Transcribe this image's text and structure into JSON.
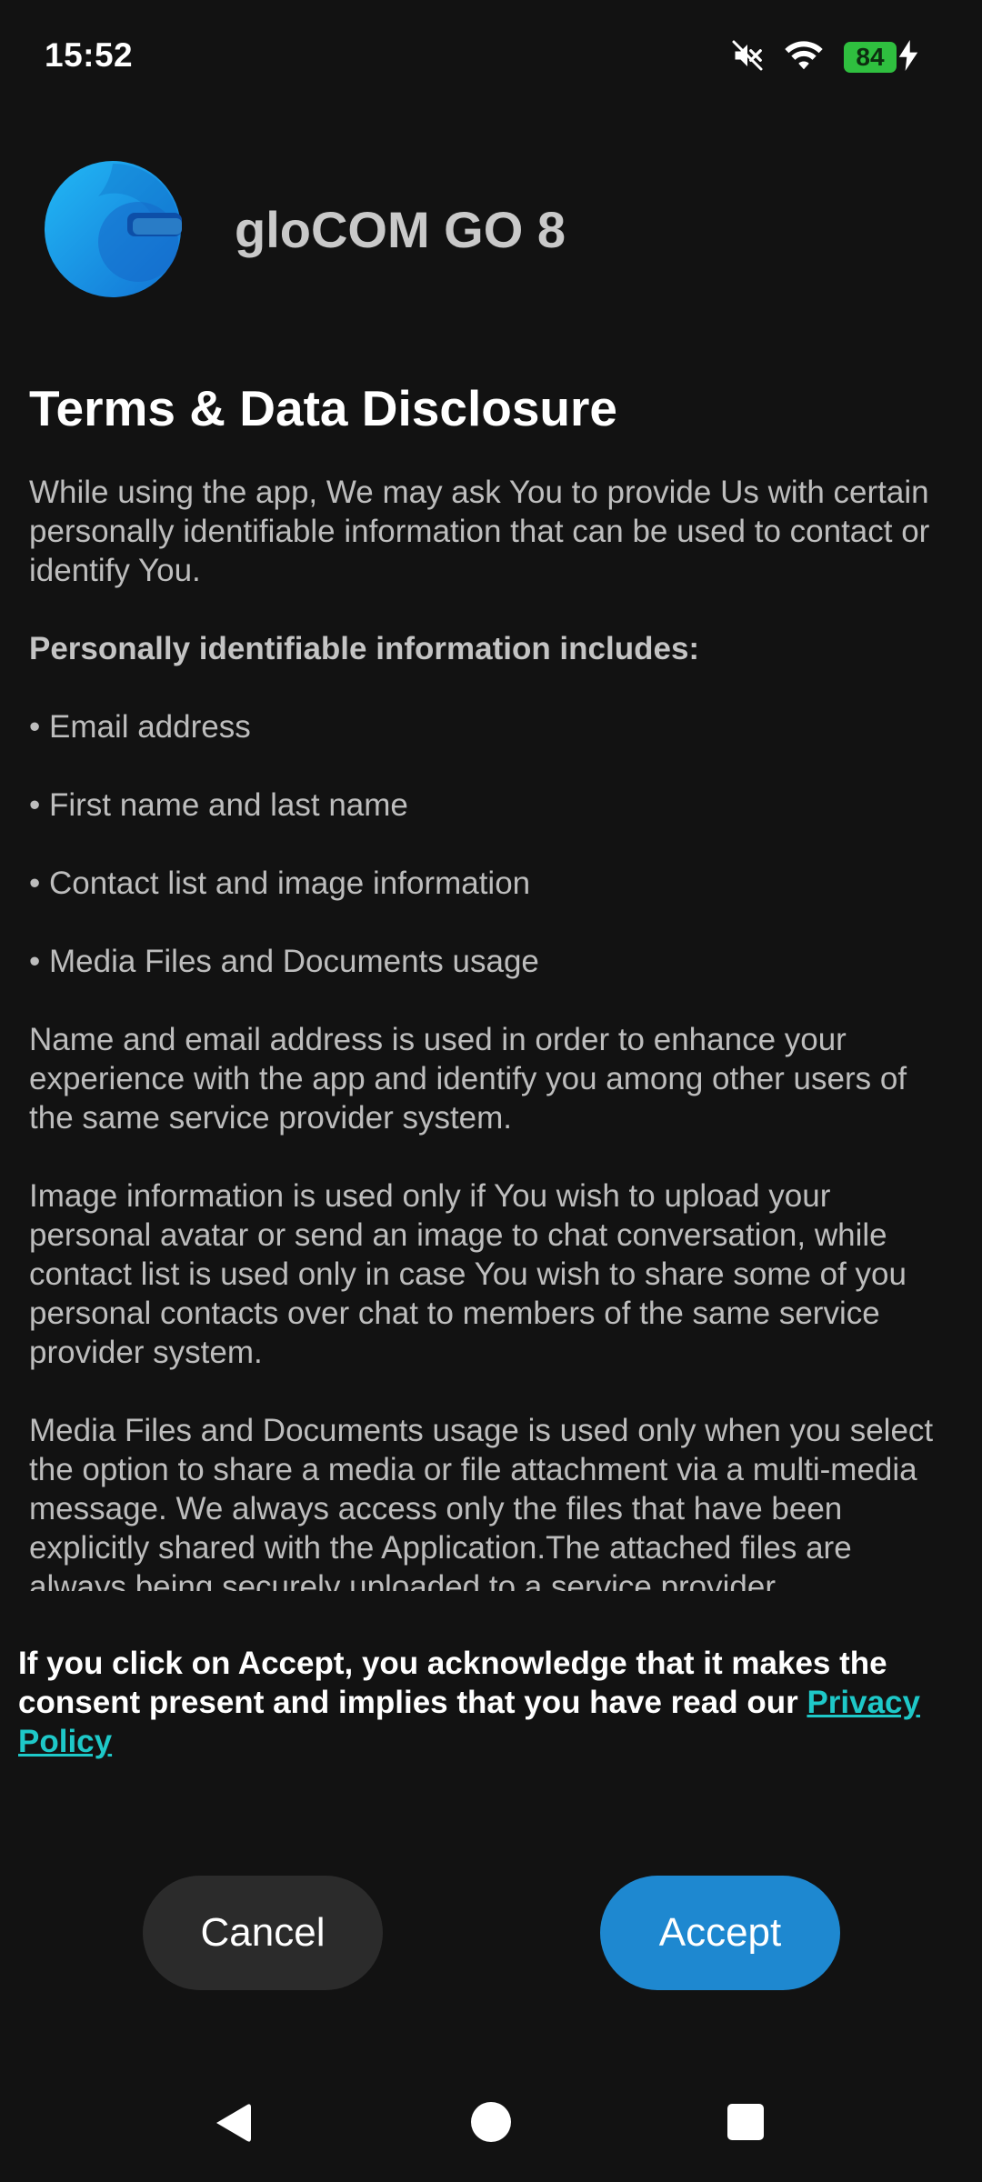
{
  "status_bar": {
    "time": "15:52",
    "battery_level": "84",
    "icons": [
      "mute-icon",
      "wifi-icon",
      "battery-icon",
      "charging-icon"
    ]
  },
  "app": {
    "title": "gloCOM GO 8",
    "logo_icon": "glocom-logo-icon",
    "brand_color": "#1e9be0"
  },
  "terms": {
    "heading": "Terms & Data Disclosure",
    "intro": "While using the app, We may ask You to provide Us with certain personally identifiable information that can be used to contact or identify You.",
    "list_title": "Personally identifiable information includes:",
    "items": [
      "• Email address",
      "• First name and last name",
      "• Contact list and image information",
      "• Media Files and Documents usage"
    ],
    "para_name_email": "Name and email address is used in order to enhance your experience with the app and identify you among other users of the same service provider system.",
    "para_image": "Image information is used only if You wish to upload your personal avatar or send an image to chat conversation, while contact list is used only in case You wish to share some of you personal contacts over chat to members of the same service provider system.",
    "para_media": "Media Files and Documents usage is used only when you select the option to share a media or file attachment via a multi-media message. We always access only the files that have been explicitly shared with the Application.The attached files are always being securely uploaded to a service provider"
  },
  "consent": {
    "text": "If you click on Accept, you acknowledge that it makes the consent present and implies that you have read our ",
    "link_label": "Privacy Policy",
    "link_color": "#1ec8c8"
  },
  "buttons": {
    "cancel_label": "Cancel",
    "accept_label": "Accept",
    "accept_color": "#1e88d0"
  },
  "nav": {
    "icons": [
      "back-icon",
      "home-icon",
      "recents-icon"
    ]
  }
}
